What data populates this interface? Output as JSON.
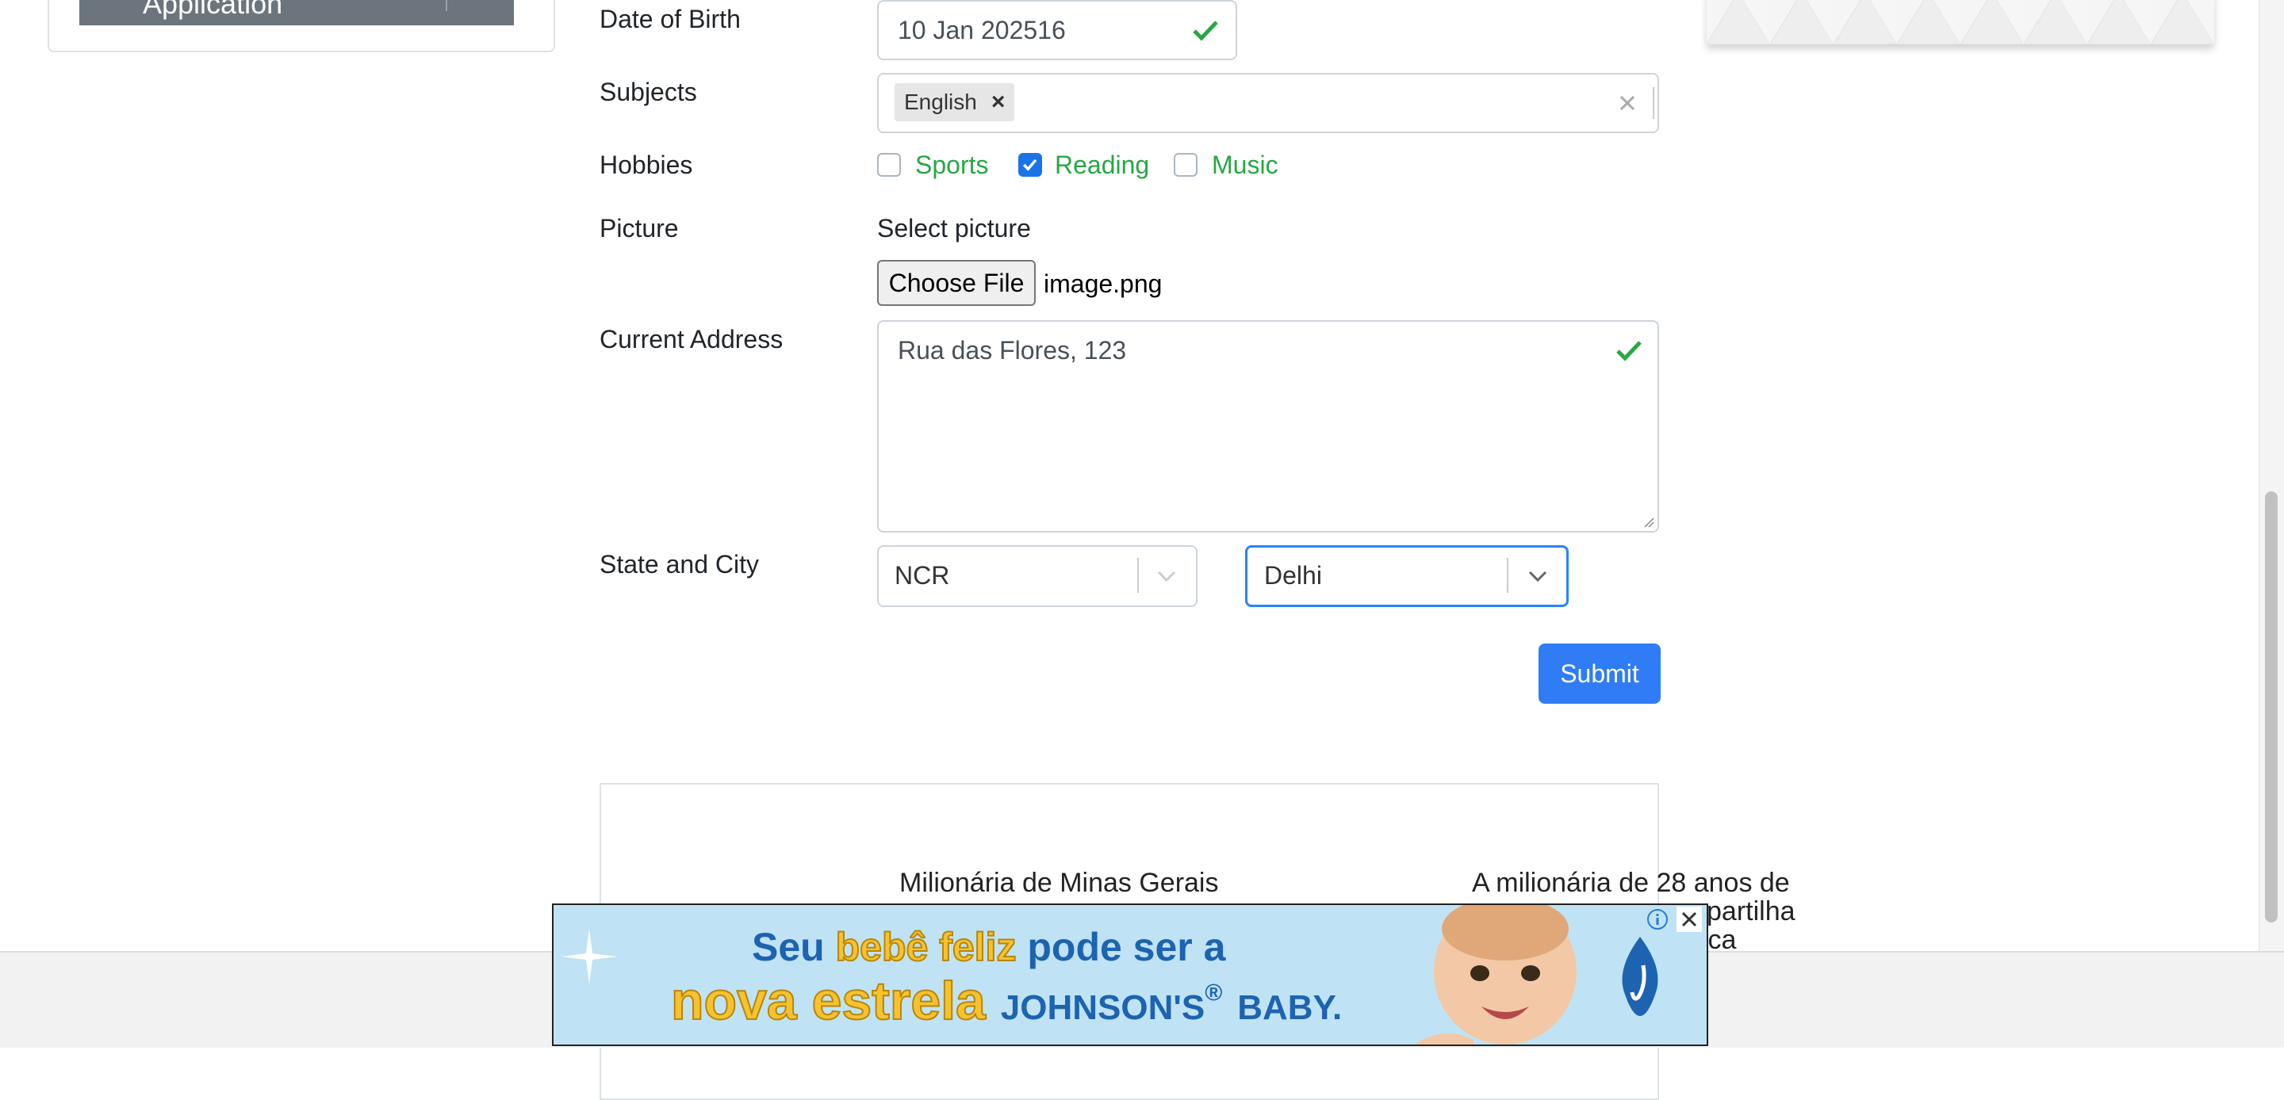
{
  "sidebar": {
    "active_item_label": "Application"
  },
  "form": {
    "dob": {
      "label": "Date of Birth",
      "value": "10 Jan 202516"
    },
    "subjects": {
      "label": "Subjects",
      "chips": [
        "English"
      ]
    },
    "hobbies": {
      "label": "Hobbies",
      "options": [
        {
          "label": "Sports",
          "checked": false
        },
        {
          "label": "Reading",
          "checked": true
        },
        {
          "label": "Music",
          "checked": false
        }
      ]
    },
    "picture": {
      "label": "Picture",
      "prompt": "Select picture",
      "button_label": "Choose File",
      "file_name": "image.png"
    },
    "address": {
      "label": "Current Address",
      "value": "Rua das Flores, 123"
    },
    "state_city": {
      "label": "State and City",
      "state": "NCR",
      "city": "Delhi"
    },
    "submit_label": "Submit"
  },
  "articles": [
    {
      "title": "Milionária de Minas Gerais"
    },
    {
      "title_line1": "A milionária de 28 anos de",
      "title_line2": "partilha",
      "title_line3": "ica"
    }
  ],
  "ad_banner": {
    "line1_pre": "Seu",
    "line1_highlight": "bebê feliz",
    "line1_post": "pode ser a",
    "line2_highlight": "nova estrela",
    "line2_brand": "JOHNSON'S",
    "line2_reg": "®",
    "line2_brand_post": "BABY."
  },
  "colors": {
    "accent": "#2f7cf6",
    "valid_green": "#28a745",
    "sidebar_item_bg": "#6c757d"
  }
}
